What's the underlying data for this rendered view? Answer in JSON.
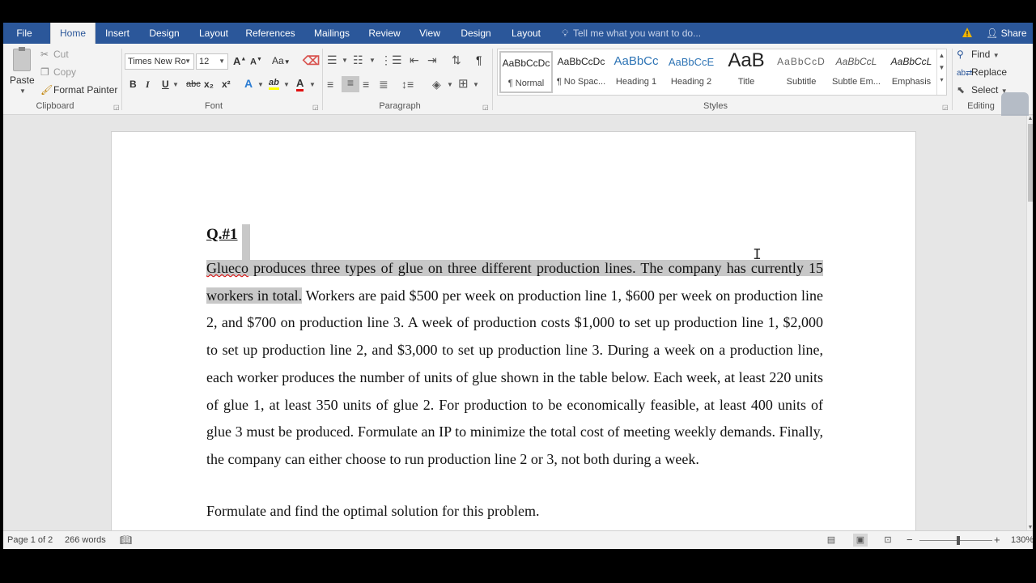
{
  "tabs": [
    "File",
    "Home",
    "Insert",
    "Design",
    "Layout",
    "References",
    "Mailings",
    "Review",
    "View",
    "Design",
    "Layout"
  ],
  "active_tab": "Home",
  "tell_me": "Tell me what you want to do...",
  "share": "Share",
  "clipboard": {
    "paste": "Paste",
    "cut": "Cut",
    "copy": "Copy",
    "format_painter": "Format Painter",
    "group_label": "Clipboard"
  },
  "font": {
    "name": "Times New Ro",
    "size": "12",
    "group_label": "Font",
    "bold": "B",
    "italic": "I",
    "underline": "U",
    "strike": "abc",
    "subscript": "x₂",
    "superscript": "x²",
    "grow": "A",
    "shrink": "A",
    "case": "Aa",
    "effects": "A",
    "highlight": "ab",
    "color": "A"
  },
  "paragraph": {
    "group_label": "Paragraph",
    "pilcrow": "¶"
  },
  "styles": {
    "group_label": "Styles",
    "items": [
      {
        "sample": "AaBbCcDc",
        "name": "¶ Normal"
      },
      {
        "sample": "AaBbCcDc",
        "name": "¶ No Spac..."
      },
      {
        "sample": "AaBbCc",
        "name": "Heading 1"
      },
      {
        "sample": "AaBbCcE",
        "name": "Heading 2"
      },
      {
        "sample": "AaB",
        "name": "Title"
      },
      {
        "sample": "AaBbCcD",
        "name": "Subtitle"
      },
      {
        "sample": "AaBbCcL",
        "name": "Subtle Em..."
      },
      {
        "sample": "AaBbCcL",
        "name": "Emphasis"
      }
    ]
  },
  "editing": {
    "group_label": "Editing",
    "find": "Find",
    "replace": "Replace",
    "select": "Select"
  },
  "document": {
    "title": "Q.#1",
    "p1_hl_a": "Glueco",
    "p1_hl_b": " produces three types of glue on three different production lines. The company has currently 15 workers in total.",
    "p1_rest": " Workers are paid $500 per week on production line 1, $600 per week on production line 2, and $700 on production line 3. A week of production costs $1,000 to set up production line 1, $2,000 to set up production line 2, and $3,000 to set up production line 3. During a week on a production line, each worker produces the number of units of glue shown in the table below. Each week, at least 220 units of glue 1, at least 350 units of glue 2. For production to be economically feasible, at least 400 units of glue 3 must be produced. Formulate an IP to minimize the total cost of meeting weekly demands. Finally, the company can either choose to run production line 2 or 3, not both during a week.",
    "p2": "Formulate and find the optimal solution for this problem."
  },
  "status": {
    "page": "Page 1 of 2",
    "words": "266 words",
    "zoom": "130%"
  },
  "colors": {
    "ribbon_blue": "#2b579a",
    "highlight_gray": "#c8c8c8"
  }
}
